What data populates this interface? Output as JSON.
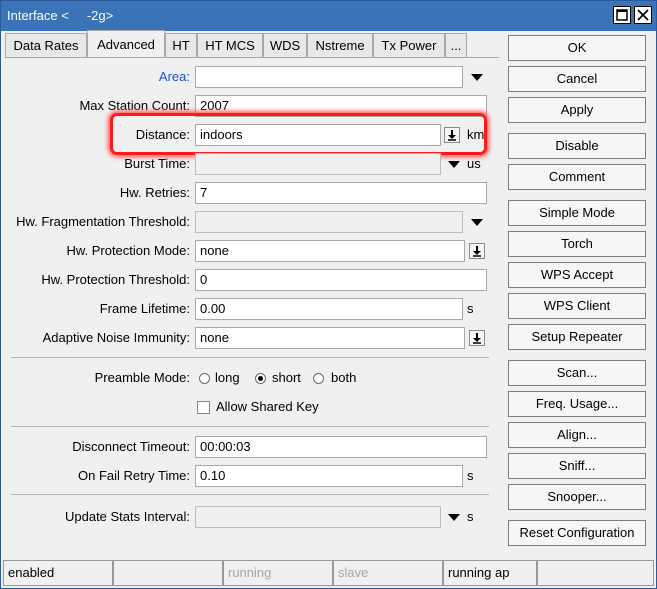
{
  "window": {
    "title": "Interface <     -2g>",
    "maximize_icon": "maximize-icon",
    "close_icon": "close-icon"
  },
  "tabs": [
    "Data Rates",
    "Advanced",
    "HT",
    "HT MCS",
    "WDS",
    "Nstreme",
    "Tx Power",
    "..."
  ],
  "active_tab": "Advanced",
  "form": {
    "area": {
      "label": "Area:",
      "value": ""
    },
    "max_station_count": {
      "label": "Max Station Count:",
      "value": "2007"
    },
    "distance": {
      "label": "Distance:",
      "value": "indoors",
      "unit": "km"
    },
    "burst_time": {
      "label": "Burst Time:",
      "value": "",
      "unit": "us"
    },
    "hw_retries": {
      "label": "Hw. Retries:",
      "value": "7"
    },
    "hw_fragmentation_threshold": {
      "label": "Hw. Fragmentation Threshold:",
      "value": ""
    },
    "hw_protection_mode": {
      "label": "Hw. Protection Mode:",
      "value": "none"
    },
    "hw_protection_threshold": {
      "label": "Hw. Protection Threshold:",
      "value": "0"
    },
    "frame_lifetime": {
      "label": "Frame Lifetime:",
      "value": "0.00",
      "unit": "s"
    },
    "adaptive_noise_immunity": {
      "label": "Adaptive Noise Immunity:",
      "value": "none"
    },
    "preamble_mode": {
      "label": "Preamble Mode:",
      "options": [
        "long",
        "short",
        "both"
      ],
      "selected": "short"
    },
    "allow_shared_key": {
      "label": "Allow Shared Key",
      "checked": false
    },
    "disconnect_timeout": {
      "label": "Disconnect Timeout:",
      "value": "00:00:03"
    },
    "on_fail_retry_time": {
      "label": "On Fail Retry Time:",
      "value": "0.10",
      "unit": "s"
    },
    "update_stats_interval": {
      "label": "Update Stats Interval:",
      "value": "",
      "unit": "s"
    }
  },
  "buttons": [
    "OK",
    "Cancel",
    "Apply",
    "Disable",
    "Comment",
    "Simple Mode",
    "Torch",
    "WPS Accept",
    "WPS Client",
    "Setup Repeater",
    "Scan...",
    "Freq. Usage...",
    "Align...",
    "Sniff...",
    "Snooper...",
    "Reset Configuration"
  ],
  "status_bar": [
    "enabled",
    "",
    "running",
    "slave",
    "running ap",
    ""
  ],
  "colors": {
    "titlebar": "#3a73b8",
    "highlight": "#ff1a1a",
    "link_label": "#1f4fd6"
  }
}
